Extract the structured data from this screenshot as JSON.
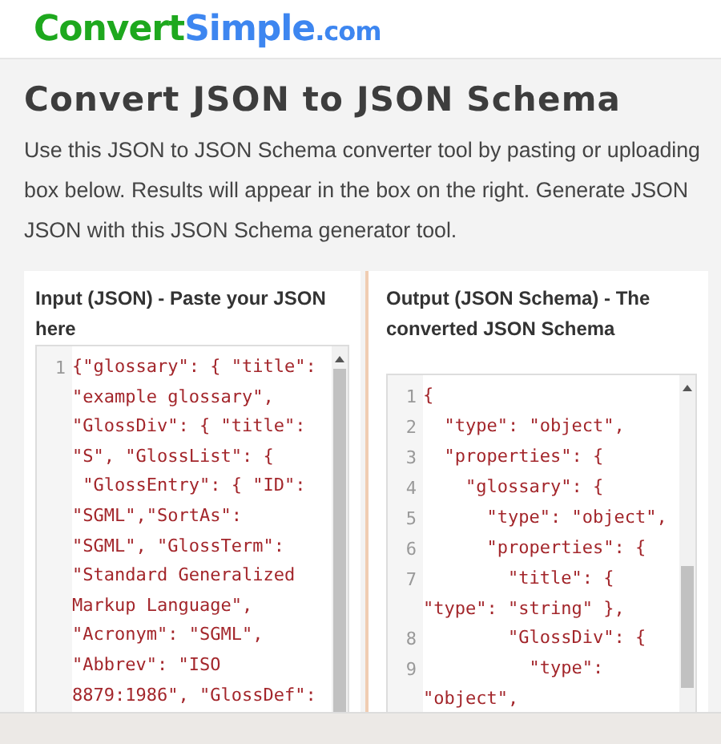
{
  "logo": {
    "first": "Convert",
    "second": "Simple",
    "domain": ".com"
  },
  "title": "Convert JSON to JSON Schema",
  "intro_lines": [
    "Use this JSON to JSON Schema converter tool by pasting or uploading",
    "box below. Results will appear in the box on the right. Generate JSON",
    "JSON with this JSON Schema generator tool."
  ],
  "panels": [
    {
      "heading": "Input (JSON) - Paste your JSON here",
      "lines": [
        {
          "number": "1",
          "rows": [
            "{\"glossary\": { \"title\":",
            "\"example glossary\",",
            "\"GlossDiv\": { \"title\":",
            "\"S\", \"GlossList\": {",
            " \"GlossEntry\": { \"ID\":",
            "\"SGML\",\"SortAs\":",
            "\"SGML\", \"GlossTerm\":",
            "\"Standard Generalized",
            "Markup Language\",",
            "\"Acronym\": \"SGML\",",
            "\"Abbrev\": \"ISO",
            "8879:1986\", \"GlossDef\":"
          ]
        }
      ]
    },
    {
      "heading": "Output (JSON Schema) - The converted JSON Schema",
      "lines": [
        {
          "number": "1",
          "rows": [
            "{"
          ]
        },
        {
          "number": "2",
          "rows": [
            "  \"type\": \"object\","
          ]
        },
        {
          "number": "3",
          "rows": [
            "  \"properties\": {"
          ]
        },
        {
          "number": "4",
          "rows": [
            "    \"glossary\": {"
          ]
        },
        {
          "number": "5",
          "rows": [
            "      \"type\": \"object\","
          ]
        },
        {
          "number": "6",
          "rows": [
            "      \"properties\": {"
          ]
        },
        {
          "number": "7",
          "rows": [
            "        \"title\": {",
            "\"type\": \"string\" },"
          ]
        },
        {
          "number": "8",
          "rows": [
            "        \"GlossDiv\": {"
          ]
        },
        {
          "number": "9",
          "rows": [
            "          \"type\":",
            "\"object\","
          ]
        }
      ]
    }
  ]
}
